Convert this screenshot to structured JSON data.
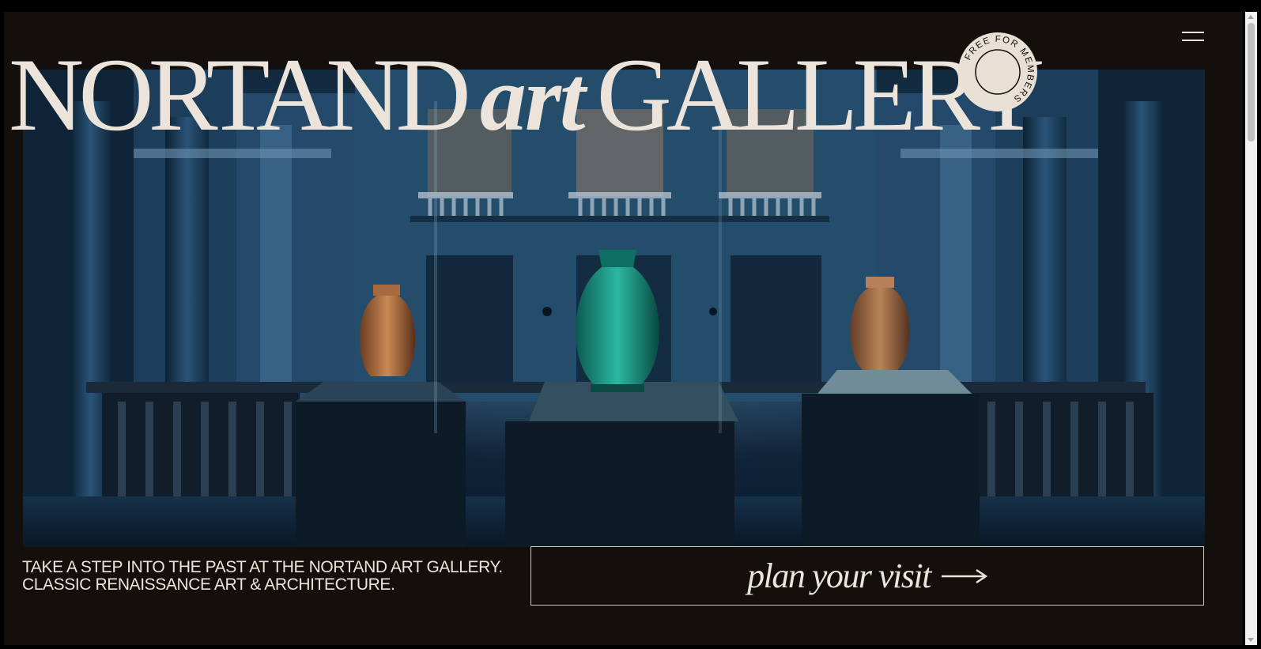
{
  "header": {
    "wordmark_part1": "NORTAND",
    "wordmark_art": "art",
    "wordmark_part2": "GALLERY",
    "badge_text": "FREE FOR MEMBERS",
    "menu_icon": "hamburger-menu-icon"
  },
  "hero": {
    "image_subject": "museum-atrium-vases"
  },
  "intro": {
    "tagline": "TAKE A STEP INTO THE PAST AT THE NORTAND ART GALLERY. CLASSIC RENAISSANCE ART & ARCHITECTURE."
  },
  "cta": {
    "label": "plan your visit",
    "arrow_icon": "long-arrow-right-icon"
  },
  "colors": {
    "background": "#120f0d",
    "text": "#ece4da",
    "hero_tint": "#1b3d58"
  }
}
